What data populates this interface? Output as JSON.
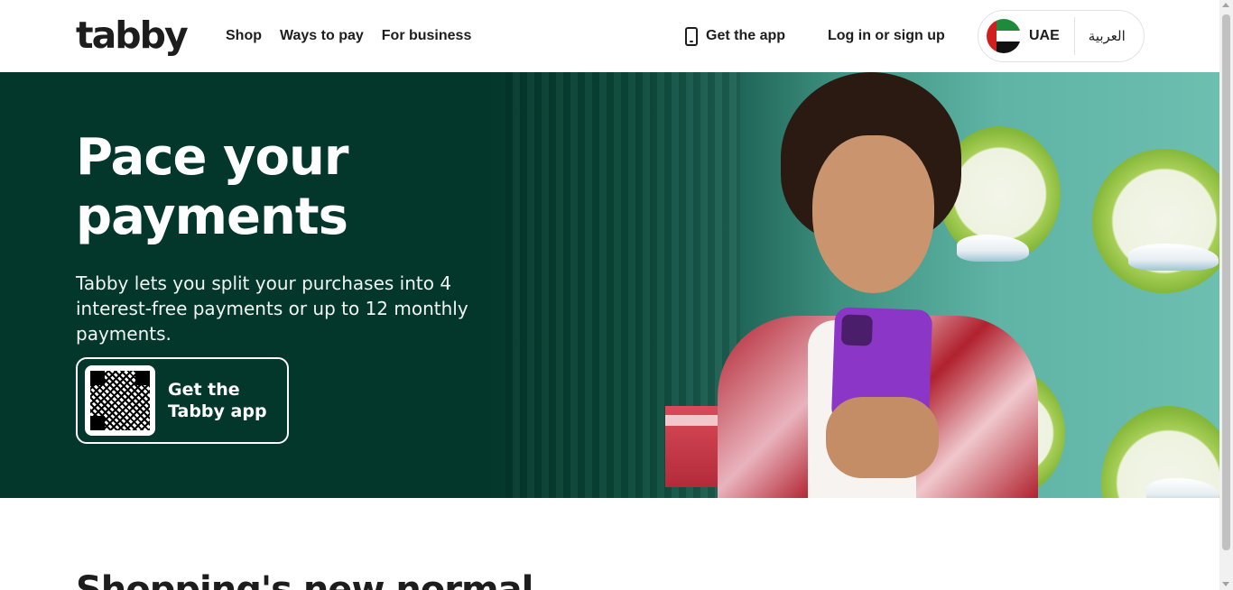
{
  "header": {
    "logo": "tabby",
    "nav": [
      {
        "label": "Shop"
      },
      {
        "label": "Ways to pay"
      },
      {
        "label": "For business"
      }
    ],
    "get_app": "Get the app",
    "login": "Log in or sign up",
    "locale": {
      "country": "UAE",
      "language": "العربية"
    }
  },
  "hero": {
    "title": "Pace your payments",
    "subtitle": "Tabby lets you split your purchases into 4 interest-free payments or up to 12 monthly payments.",
    "qr_card": {
      "label": "Get the Tabby app"
    }
  },
  "next_section": {
    "title": "Shopping's new normal"
  },
  "colors": {
    "hero_background": "#04372b",
    "text_dark": "#1d1d1d",
    "white": "#ffffff"
  },
  "icons": {
    "phone": "phone-icon",
    "flag": "uae-flag-icon",
    "qr": "qr-code-icon"
  }
}
